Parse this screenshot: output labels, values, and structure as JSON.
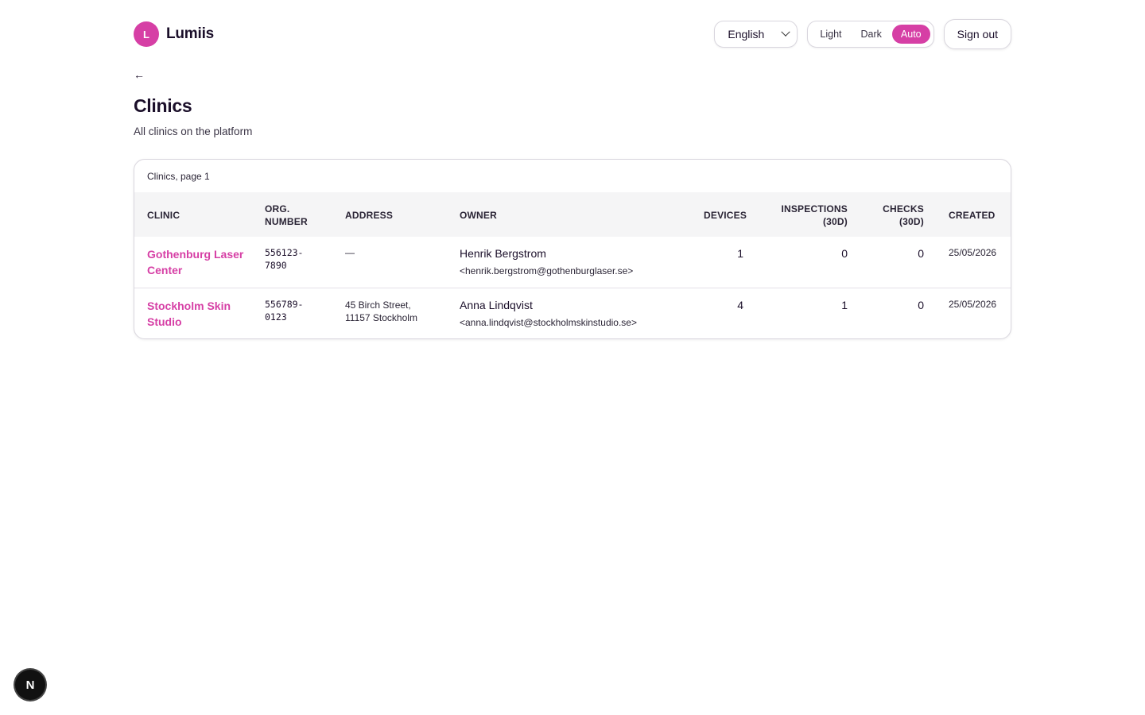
{
  "brand": {
    "logo_letter": "L",
    "name": "Lumiis",
    "accent": "#d63fa5"
  },
  "header": {
    "language": "English",
    "theme_options": [
      "Light",
      "Dark",
      "Auto"
    ],
    "theme_selected": "Auto",
    "signout_label": "Sign out"
  },
  "nav": {
    "back": "←"
  },
  "page": {
    "title": "Clinics",
    "subtitle": "All clinics on the platform"
  },
  "table": {
    "caption": "Clinics, page 1",
    "columns": {
      "clinic": "CLINIC",
      "org_number": "ORG. NUMBER",
      "address": "ADDRESS",
      "owner": "OWNER",
      "devices": "DEVICES",
      "inspections": "INSPECTIONS (30D)",
      "checks": "CHECKS (30D)",
      "created": "CREATED"
    },
    "rows": [
      {
        "clinic": "Gothenburg Laser Center",
        "org_number": "556123-7890",
        "address": "—",
        "owner_name": "Henrik Bergstrom",
        "owner_email": "<henrik.bergstrom@gothenburglaser.se>",
        "devices": "1",
        "inspections": "0",
        "checks": "0",
        "created": "25/05/2026"
      },
      {
        "clinic": "Stockholm Skin Studio",
        "org_number": "556789-0123",
        "address": "45 Birch Street, 11157 Stockholm",
        "owner_name": "Anna Lindqvist",
        "owner_email": "<anna.lindqvist@stockholmskinstudio.se>",
        "devices": "4",
        "inspections": "1",
        "checks": "0",
        "created": "25/05/2026"
      }
    ]
  },
  "devtools": {
    "badge": "N"
  }
}
